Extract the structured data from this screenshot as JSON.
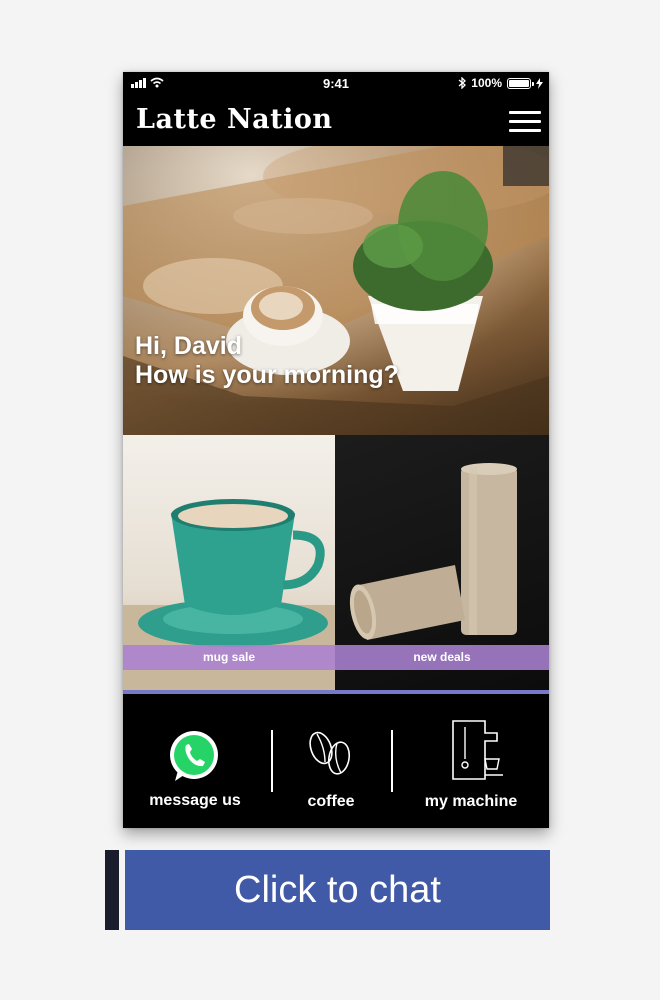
{
  "status_bar": {
    "time": "9:41",
    "battery": "100%",
    "battery_level": 1.0
  },
  "header": {
    "brand": "Latte Nation",
    "menu_icon": "hamburger-menu-icon"
  },
  "hero": {
    "greeting_line1": "Hi, David",
    "greeting_line2": "How is your morning?"
  },
  "tiles": [
    {
      "label": "mug sale",
      "image": "teal-coffee-cup"
    },
    {
      "label": "new deals",
      "image": "kraft-paper-tubes"
    }
  ],
  "bottom_nav": [
    {
      "label": "message us",
      "icon": "whatsapp-icon"
    },
    {
      "label": "coffee",
      "icon": "coffee-beans-icon"
    },
    {
      "label": "my machine",
      "icon": "coffee-machine-icon"
    }
  ],
  "chat_button": {
    "label": "Click to chat"
  },
  "colors": {
    "phone_bg": "#000000",
    "tile_label_bg": "#aa82d2",
    "divider": "#7878c8",
    "chat_button": "#415aa7",
    "chat_accent": "#1a1e2c",
    "whatsapp_green": "#25d366"
  }
}
